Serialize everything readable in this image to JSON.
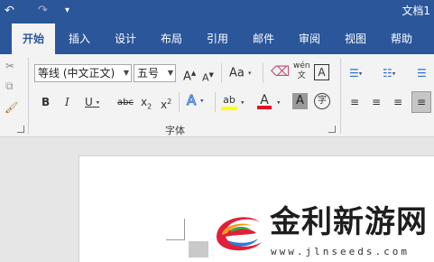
{
  "titlebar": {
    "undo_icon": "undo-icon",
    "redo_icon": "redo-icon",
    "customize_icon": "customize-quick-access-icon",
    "doc_title": "文档1"
  },
  "tabs": [
    {
      "label": "开始",
      "active": true
    },
    {
      "label": "插入"
    },
    {
      "label": "设计"
    },
    {
      "label": "布局"
    },
    {
      "label": "引用"
    },
    {
      "label": "邮件"
    },
    {
      "label": "审阅"
    },
    {
      "label": "视图"
    },
    {
      "label": "帮助"
    }
  ],
  "font": {
    "name": "等线 (中文正文)",
    "size": "五号",
    "group_label": "字体",
    "grow_label": "A",
    "shrink_label": "A",
    "case_label": "Aa",
    "phonetic_label": "wén\n文",
    "border_label": "A",
    "bold": "B",
    "italic": "I",
    "underline": "U",
    "strike": "abc",
    "subscript_base": "x",
    "subscript_mark": "2",
    "superscript_base": "x",
    "superscript_mark": "2",
    "effect_label": "A",
    "highlight_label": "ab",
    "color_label": "A",
    "shade_label": "A",
    "enclose_label": "字"
  },
  "colors": {
    "brand": "#2b579a",
    "highlight": "#ffff00",
    "font_color": "#e81123"
  },
  "watermark": {
    "title": "金利新游网",
    "url": "www.jlnseeds.com"
  }
}
